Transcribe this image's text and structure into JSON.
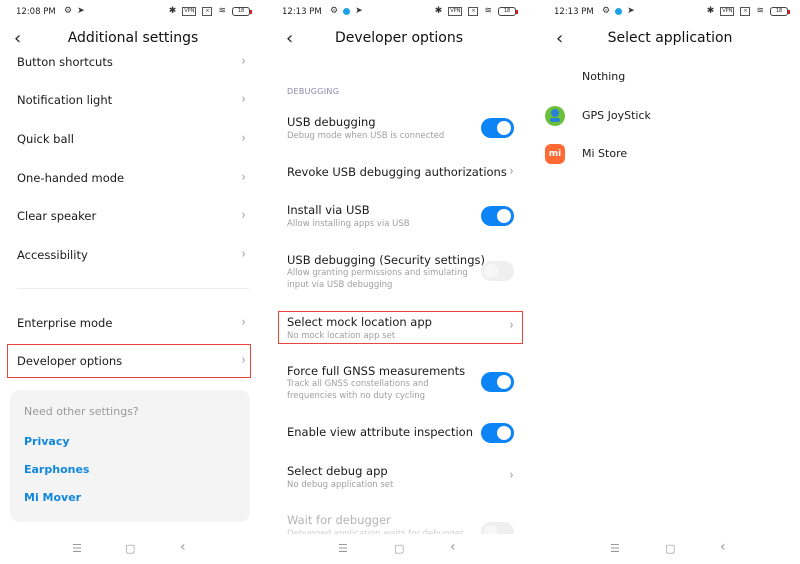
{
  "screens": [
    {
      "status": {
        "time": "12:08 PM",
        "battery": "18"
      },
      "title": "Additional settings",
      "items": [
        {
          "label": "Button shortcuts"
        },
        {
          "label": "Notification light"
        },
        {
          "label": "Quick ball"
        },
        {
          "label": "One-handed mode"
        },
        {
          "label": "Clear speaker"
        },
        {
          "label": "Accessibility"
        },
        {
          "label": "Enterprise mode"
        },
        {
          "label": "Developer options",
          "highlighted": true
        }
      ],
      "card": {
        "hint": "Need other settings?",
        "links": [
          "Privacy",
          "Earphones",
          "Mi Mover"
        ]
      }
    },
    {
      "status": {
        "time": "12:13 PM",
        "battery": "18"
      },
      "title": "Developer options",
      "section": "DEBUGGING",
      "options": [
        {
          "title": "USB debugging",
          "subtitle": "Debug mode when USB is connected",
          "control": "toggle",
          "on": true
        },
        {
          "title": "Revoke USB debugging authorizations",
          "subtitle": "",
          "control": "chevron"
        },
        {
          "title": "Install via USB",
          "subtitle": "Allow installing apps via USB",
          "control": "toggle",
          "on": true
        },
        {
          "title": "USB debugging (Security settings)",
          "subtitle": "Allow granting permissions and simulating input via USB debugging",
          "control": "toggle",
          "on": false
        },
        {
          "title": "Select mock location app",
          "subtitle": "No mock location app set",
          "control": "chevron",
          "highlighted": true
        },
        {
          "title": "Force full GNSS measurements",
          "subtitle": "Track all GNSS constellations and frequencies with no duty cycling",
          "control": "toggle",
          "on": true
        },
        {
          "title": "Enable view attribute inspection",
          "subtitle": "",
          "control": "toggle",
          "on": true
        },
        {
          "title": "Select debug app",
          "subtitle": "No debug application set",
          "control": "chevron"
        },
        {
          "title": "Wait for debugger",
          "subtitle": "Debugged application waits for debugger",
          "control": "toggle",
          "on": false,
          "disabled": true
        }
      ]
    },
    {
      "status": {
        "time": "12:13 PM",
        "battery": "18"
      },
      "title": "Select application",
      "apps": [
        {
          "name": "Nothing",
          "icon": "none"
        },
        {
          "name": "GPS JoyStick",
          "icon": "gps-joystick-icon"
        },
        {
          "name": "Mi Store",
          "icon": "mi-store-icon",
          "icon_text": "mi"
        }
      ]
    }
  ],
  "icons": {
    "back": "‹",
    "chevron": "›",
    "bluetooth": "✱",
    "vpn": "VPN",
    "wifi": "◠",
    "nav_menu": "☰",
    "nav_home": "▢",
    "nav_back": "‹"
  },
  "colors": {
    "accent": "#0d84f5",
    "link": "#0f87e0",
    "highlight": "#e8453c",
    "mi_orange": "#ff6a34"
  }
}
